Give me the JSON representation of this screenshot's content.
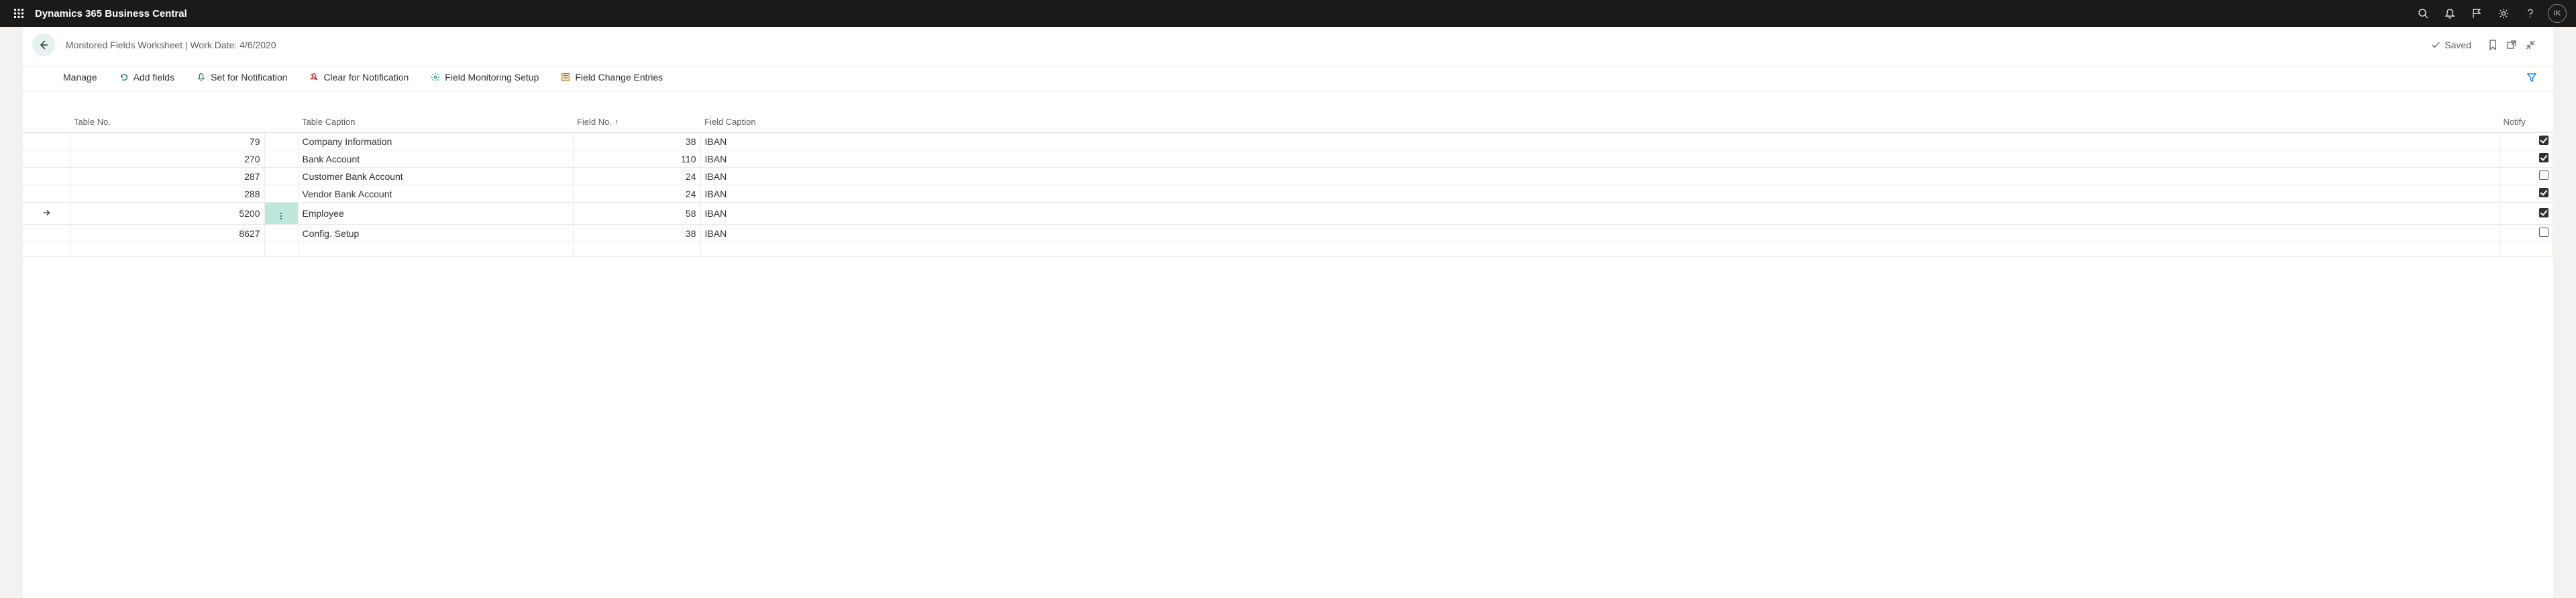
{
  "header": {
    "app_title": "Dynamics 365 Business Central",
    "avatar_initials": "IK"
  },
  "page": {
    "breadcrumb": "Monitored Fields Worksheet | Work Date: 4/6/2020",
    "saved_label": "Saved"
  },
  "toolbar": {
    "manage": "Manage",
    "add_fields": "Add fields",
    "set_notify": "Set for Notification",
    "clear_notify": "Clear for Notification",
    "setup": "Field Monitoring Setup",
    "entries": "Field Change Entries"
  },
  "table": {
    "headers": {
      "table_no": "Table No.",
      "table_caption": "Table Caption",
      "field_no": "Field No.",
      "field_caption": "Field Caption",
      "notify": "Notify"
    },
    "rows": [
      {
        "selected": false,
        "table_no": "79",
        "table_caption": "Company Information",
        "field_no": "38",
        "field_caption": "IBAN",
        "notify": true
      },
      {
        "selected": false,
        "table_no": "270",
        "table_caption": "Bank Account",
        "field_no": "110",
        "field_caption": "IBAN",
        "notify": true
      },
      {
        "selected": false,
        "table_no": "287",
        "table_caption": "Customer Bank Account",
        "field_no": "24",
        "field_caption": "IBAN",
        "notify": false
      },
      {
        "selected": false,
        "table_no": "288",
        "table_caption": "Vendor Bank Account",
        "field_no": "24",
        "field_caption": "IBAN",
        "notify": true
      },
      {
        "selected": true,
        "table_no": "5200",
        "table_caption": "Employee",
        "field_no": "58",
        "field_caption": "IBAN",
        "notify": true
      },
      {
        "selected": false,
        "table_no": "8627",
        "table_caption": "Config. Setup",
        "field_no": "38",
        "field_caption": "IBAN",
        "notify": false
      }
    ]
  }
}
